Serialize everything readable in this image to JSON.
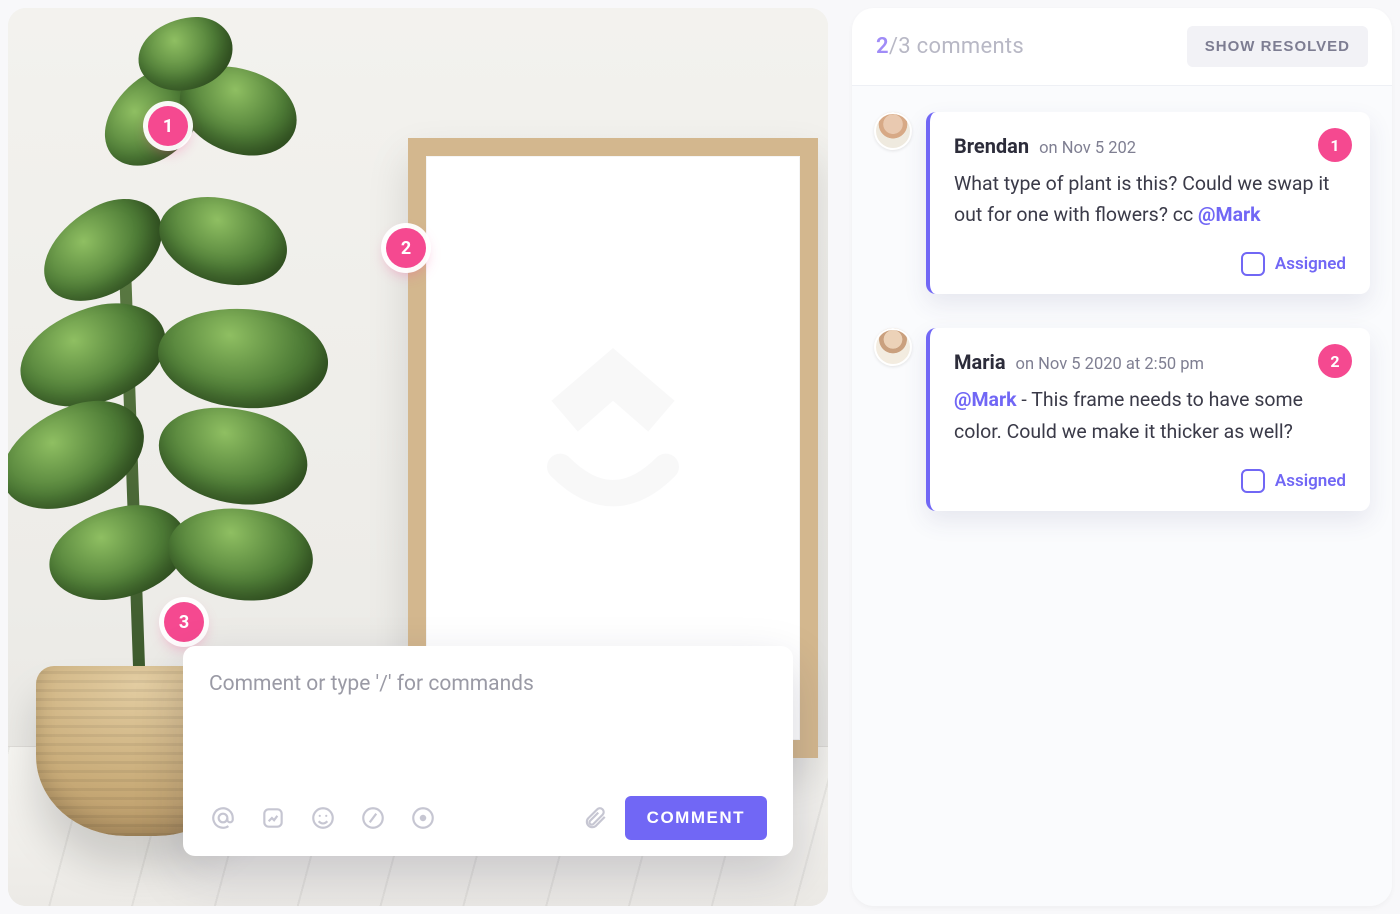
{
  "header": {
    "active_count": "2",
    "sep_and_total": "/3 comments",
    "show_resolved": "SHOW RESOLVED"
  },
  "composer": {
    "placeholder": "Comment or type '/' for commands",
    "submit_label": "COMMENT"
  },
  "pins": {
    "p1": "1",
    "p2": "2",
    "p3": "3"
  },
  "threads": [
    {
      "author": "Brendan",
      "ts": "on Nov 5 202",
      "pin": "1",
      "body_pre": "What type of plant is this? Could we swap it out for one with flowers? cc ",
      "mention": "@Mark",
      "body_post": "",
      "assigned_label": "Assigned",
      "avatar_bg": "radial-gradient(circle at 50% 32%, #e9c9b0 30%, #d7a986 31% 44%, #efeadf 45%)"
    },
    {
      "author": "Maria",
      "ts": "on Nov 5 2020 at 2:50 pm",
      "pin": "2",
      "body_pre": "",
      "mention": "@Mark",
      "body_post": " - This frame needs to have some color. Could we make it thicker as well?",
      "assigned_label": "Assigned",
      "avatar_bg": "radial-gradient(circle at 50% 30%, #ecd2b8 28%, #caa07e 29% 42%, #f3ece0 43%)"
    }
  ]
}
